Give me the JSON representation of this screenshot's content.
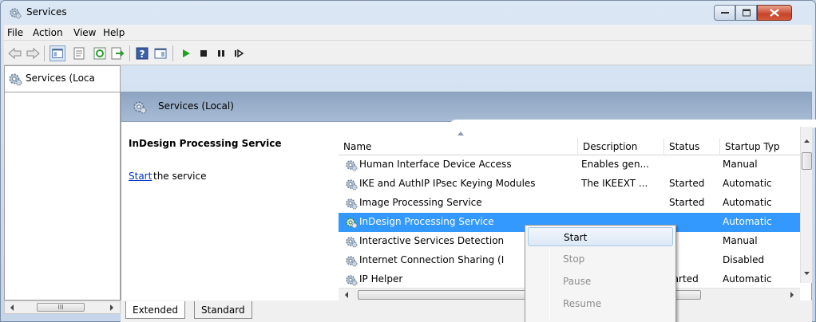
{
  "window": {
    "title": "Services"
  },
  "menubar": {
    "items": [
      "File",
      "Action",
      "View",
      "Help"
    ]
  },
  "toolbar": {
    "buttons": [
      "back-icon",
      "forward-icon",
      "console-tree-icon",
      "properties-icon",
      "refresh-icon",
      "export-icon",
      "help-icon",
      "show-hide-icon",
      "play-icon",
      "stop-icon",
      "pause-icon",
      "resume-icon"
    ]
  },
  "tree": {
    "item_label": "Services (Loca"
  },
  "header": {
    "title": "Services (Local)"
  },
  "description_panel": {
    "service_name": "InDesign Processing Service",
    "start_link": "Start",
    "start_rest": " the service"
  },
  "list": {
    "columns": [
      "Name",
      "Description",
      "Status",
      "Startup Typ"
    ],
    "rows": [
      {
        "name": "Human Interface Device Access",
        "description": "Enables gen...",
        "status": "",
        "startup": "Manual"
      },
      {
        "name": "IKE and AuthIP IPsec Keying Modules",
        "description": "The IKEEXT ...",
        "status": "Started",
        "startup": "Automatic"
      },
      {
        "name": "Image Processing Service",
        "description": "",
        "status": "Started",
        "startup": "Automatic"
      },
      {
        "name": "InDesign Processing Service",
        "description": "",
        "status": "",
        "startup": "Automatic"
      },
      {
        "name": "Interactive Services Detection",
        "description": "",
        "status": "",
        "startup": "Manual"
      },
      {
        "name": "Internet Connection Sharing (I",
        "description": "",
        "status": "",
        "startup": "Disabled"
      },
      {
        "name": "IP Helper",
        "description": "",
        "status": "tarted",
        "startup": "Automatic"
      }
    ],
    "selected_index": 3
  },
  "scroll": {
    "left_thumb_label": "III"
  },
  "tabs": [
    "Extended",
    "Standard"
  ],
  "context_menu": {
    "items": [
      {
        "label": "Start",
        "enabled": true
      },
      {
        "label": "Stop",
        "enabled": false
      },
      {
        "label": "Pause",
        "enabled": false
      },
      {
        "label": "Resume",
        "enabled": false
      }
    ]
  },
  "colors": {
    "selection": "#3399ff",
    "link": "#0033cc",
    "header_band": "#9bb0cc"
  }
}
